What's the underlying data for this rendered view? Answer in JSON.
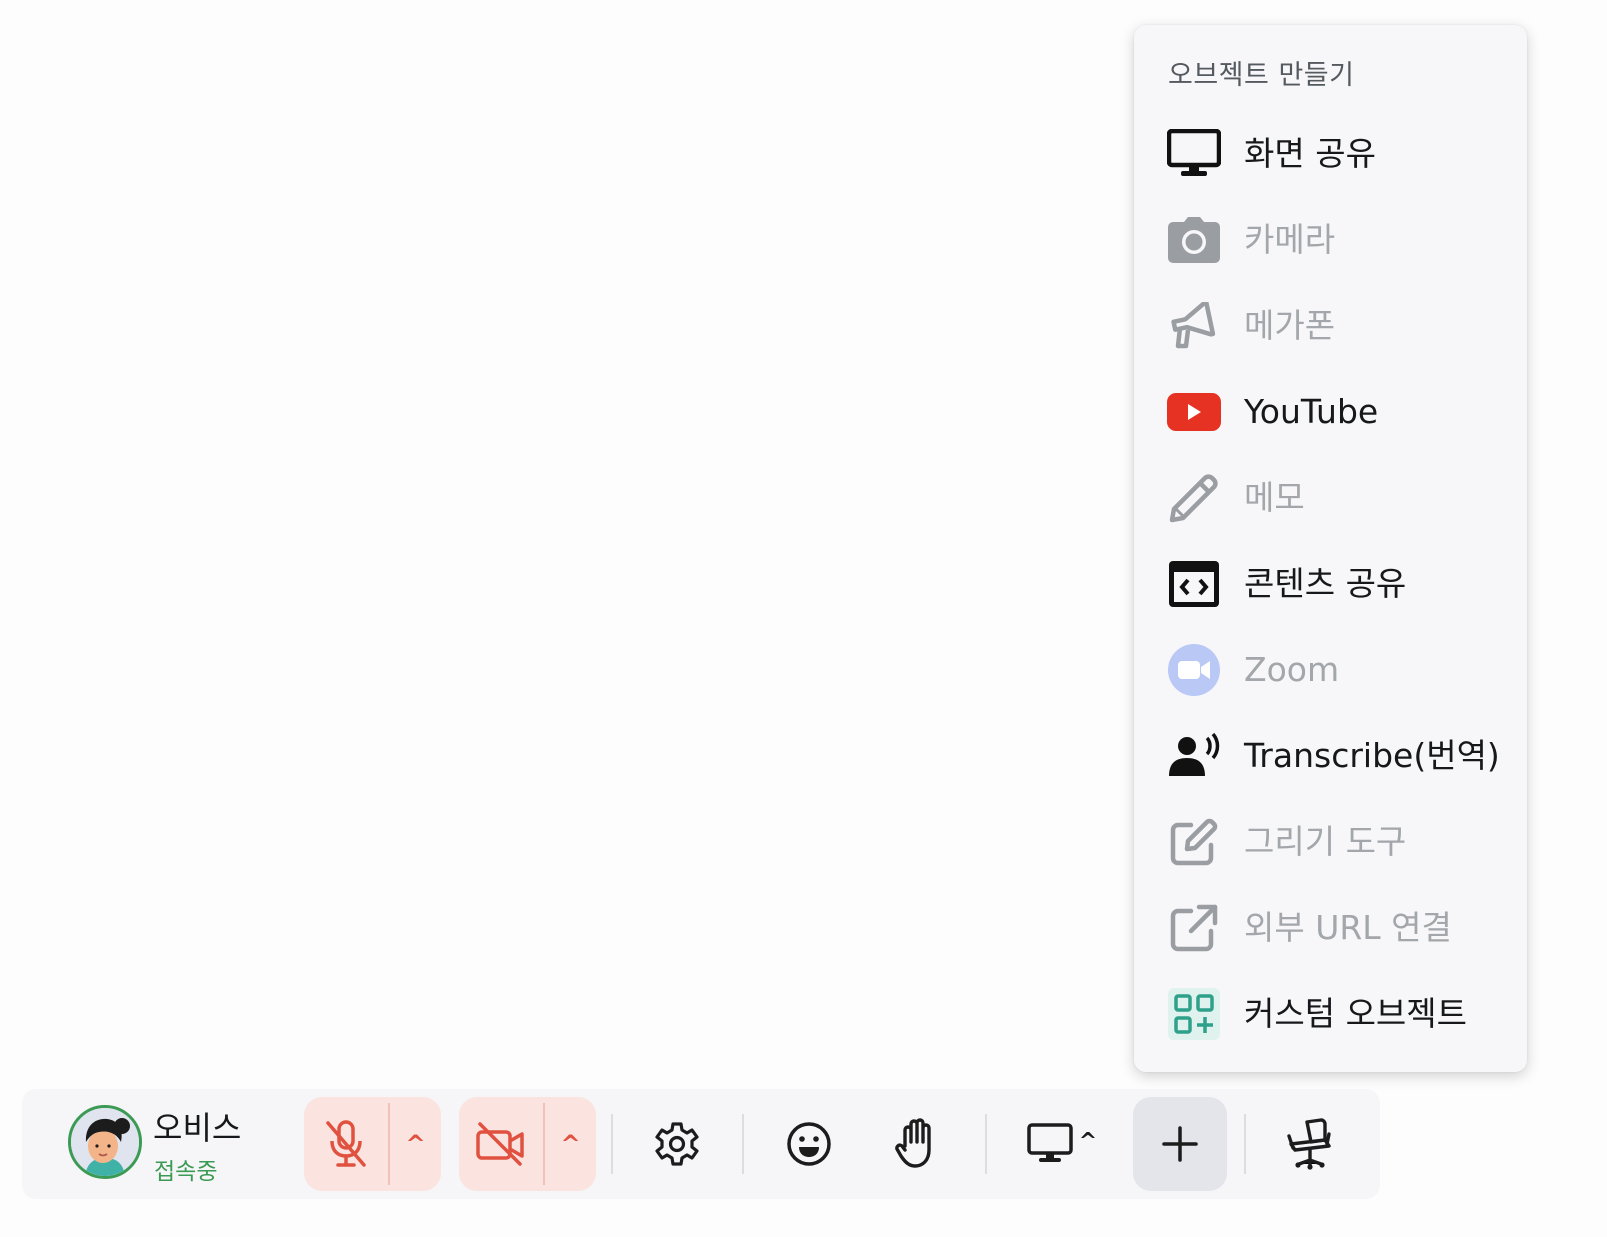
{
  "menu": {
    "title": "오브젝트 만들기",
    "items": [
      {
        "label": "화면 공유",
        "icon": "monitor-icon",
        "enabled": true
      },
      {
        "label": "카메라",
        "icon": "camera-icon",
        "enabled": false
      },
      {
        "label": "메가폰",
        "icon": "megaphone-icon",
        "enabled": false
      },
      {
        "label": "YouTube",
        "icon": "youtube-icon",
        "enabled": true
      },
      {
        "label": "메모",
        "icon": "pencil-icon",
        "enabled": false
      },
      {
        "label": "콘텐츠 공유",
        "icon": "embed-code-icon",
        "enabled": true
      },
      {
        "label": "Zoom",
        "icon": "zoom-icon",
        "enabled": false
      },
      {
        "label": "Transcribe(번역)",
        "icon": "speaking-person-icon",
        "enabled": true
      },
      {
        "label": "그리기 도구",
        "icon": "edit-square-icon",
        "enabled": false
      },
      {
        "label": "외부 URL 연결",
        "icon": "external-link-icon",
        "enabled": false
      },
      {
        "label": "커스텀 오브젝트",
        "icon": "custom-object-icon",
        "enabled": true
      }
    ]
  },
  "toolbar": {
    "user": {
      "name": "오비스",
      "status": "접속중"
    },
    "mic_caret": "^",
    "camera_caret": "^",
    "screen_caret": "^"
  },
  "colors": {
    "status_green": "#3b9a54",
    "muted_red": "#e0523f",
    "muted_bg": "#fbe3e0",
    "youtube_red": "#e63222",
    "zoom_blue": "#b9c8f5",
    "custom_teal": "#2fa08a"
  }
}
